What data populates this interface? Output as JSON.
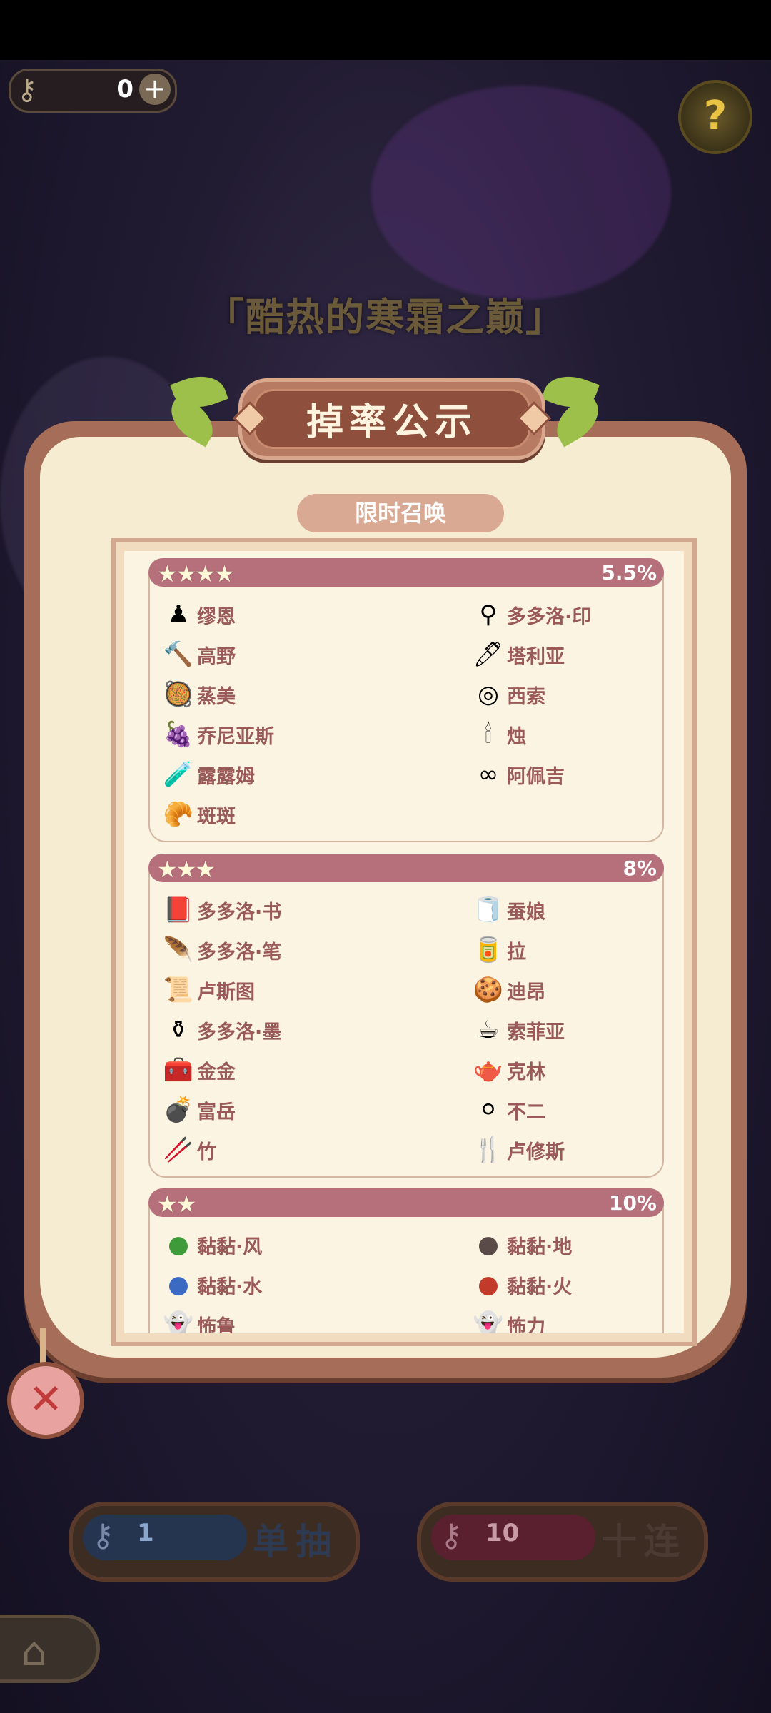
{
  "hud": {
    "key_count": "0",
    "key_icon": "key-icon",
    "plus_icon": "plus-icon",
    "help_icon": "help-icon"
  },
  "event_title": "「酷热的寒霜之巅」",
  "modal": {
    "title": "掉率公示",
    "subtab": "限时召唤",
    "sections": [
      {
        "stars": "★★★★",
        "rate": "5.5%",
        "items": [
          {
            "name": "缪恩",
            "icon": "♟"
          },
          {
            "name": "多多洛·印",
            "icon": "⚲"
          },
          {
            "name": "高野",
            "icon": "🔨"
          },
          {
            "name": "塔利亚",
            "icon": "🖊"
          },
          {
            "name": "蒸美",
            "icon": "🥘"
          },
          {
            "name": "西索",
            "icon": "◎"
          },
          {
            "name": "乔尼亚斯",
            "icon": "🍇"
          },
          {
            "name": "烛",
            "icon": "🕯"
          },
          {
            "name": "露露姆",
            "icon": "🧪"
          },
          {
            "name": "阿佩吉",
            "icon": "∞"
          },
          {
            "name": "斑斑",
            "icon": "🥐"
          }
        ]
      },
      {
        "stars": "★★★",
        "rate": "8%",
        "items": [
          {
            "name": "多多洛·书",
            "icon": "📕"
          },
          {
            "name": "蚕娘",
            "icon": "🧻"
          },
          {
            "name": "多多洛·笔",
            "icon": "🪶"
          },
          {
            "name": "拉",
            "icon": "🥫"
          },
          {
            "name": "卢斯图",
            "icon": "📜"
          },
          {
            "name": "迪昂",
            "icon": "🍪"
          },
          {
            "name": "多多洛·墨",
            "icon": "⚱"
          },
          {
            "name": "索菲亚",
            "icon": "☕"
          },
          {
            "name": "金金",
            "icon": "🧰"
          },
          {
            "name": "克林",
            "icon": "🫖"
          },
          {
            "name": "富岳",
            "icon": "💣"
          },
          {
            "name": "不二",
            "icon": "⚪"
          },
          {
            "name": "竹",
            "icon": "🥢"
          },
          {
            "name": "卢修斯",
            "icon": "🍴"
          }
        ]
      },
      {
        "stars": "★★",
        "rate": "10%",
        "items": [
          {
            "name": "黏黏·风",
            "icon": "●",
            "color": "#3f9a3a"
          },
          {
            "name": "黏黏·地",
            "icon": "●",
            "color": "#5a4a48"
          },
          {
            "name": "黏黏·水",
            "icon": "●",
            "color": "#3a6ac2"
          },
          {
            "name": "黏黏·火",
            "icon": "●",
            "color": "#c23a2a"
          },
          {
            "name": "怖鲁",
            "icon": "👻"
          },
          {
            "name": "怖力",
            "icon": "👻"
          }
        ]
      }
    ]
  },
  "close_icon": "close-icon",
  "draw_single": {
    "count": "1",
    "label": "单抽"
  },
  "draw_ten": {
    "count": "10",
    "label": "十连"
  },
  "home_icon": "home-icon"
}
